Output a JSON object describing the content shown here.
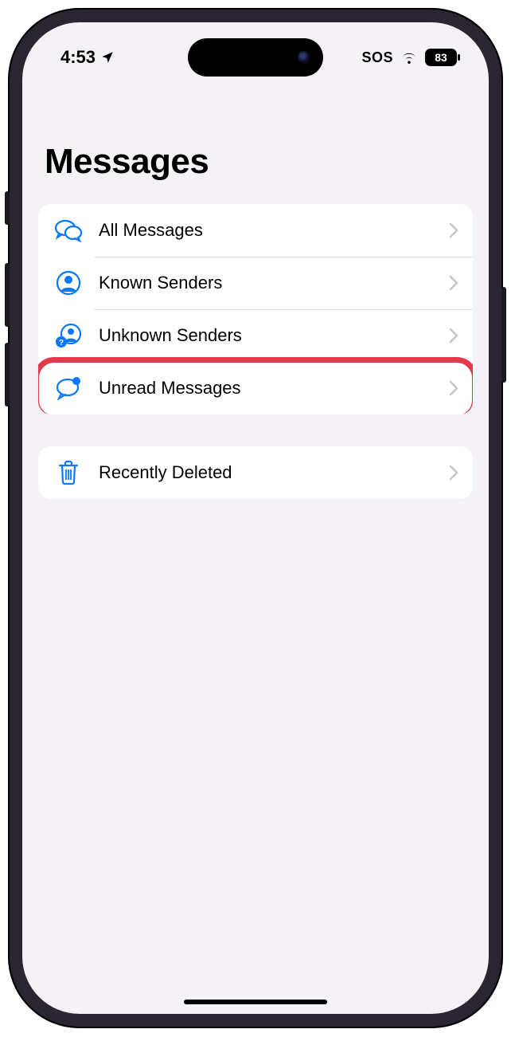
{
  "status": {
    "time": "4:53",
    "sos": "SOS",
    "battery": "83"
  },
  "title": "Messages",
  "filters": [
    {
      "icon": "chat-bubbles",
      "label": "All Messages"
    },
    {
      "icon": "person-circle",
      "label": "Known Senders"
    },
    {
      "icon": "person-question",
      "label": "Unknown Senders"
    },
    {
      "icon": "bubble-dot",
      "label": "Unread Messages",
      "highlighted": true
    }
  ],
  "trash": {
    "icon": "trash",
    "label": "Recently Deleted"
  },
  "colors": {
    "accent": "#0879ff",
    "highlight": "#e2394c"
  }
}
